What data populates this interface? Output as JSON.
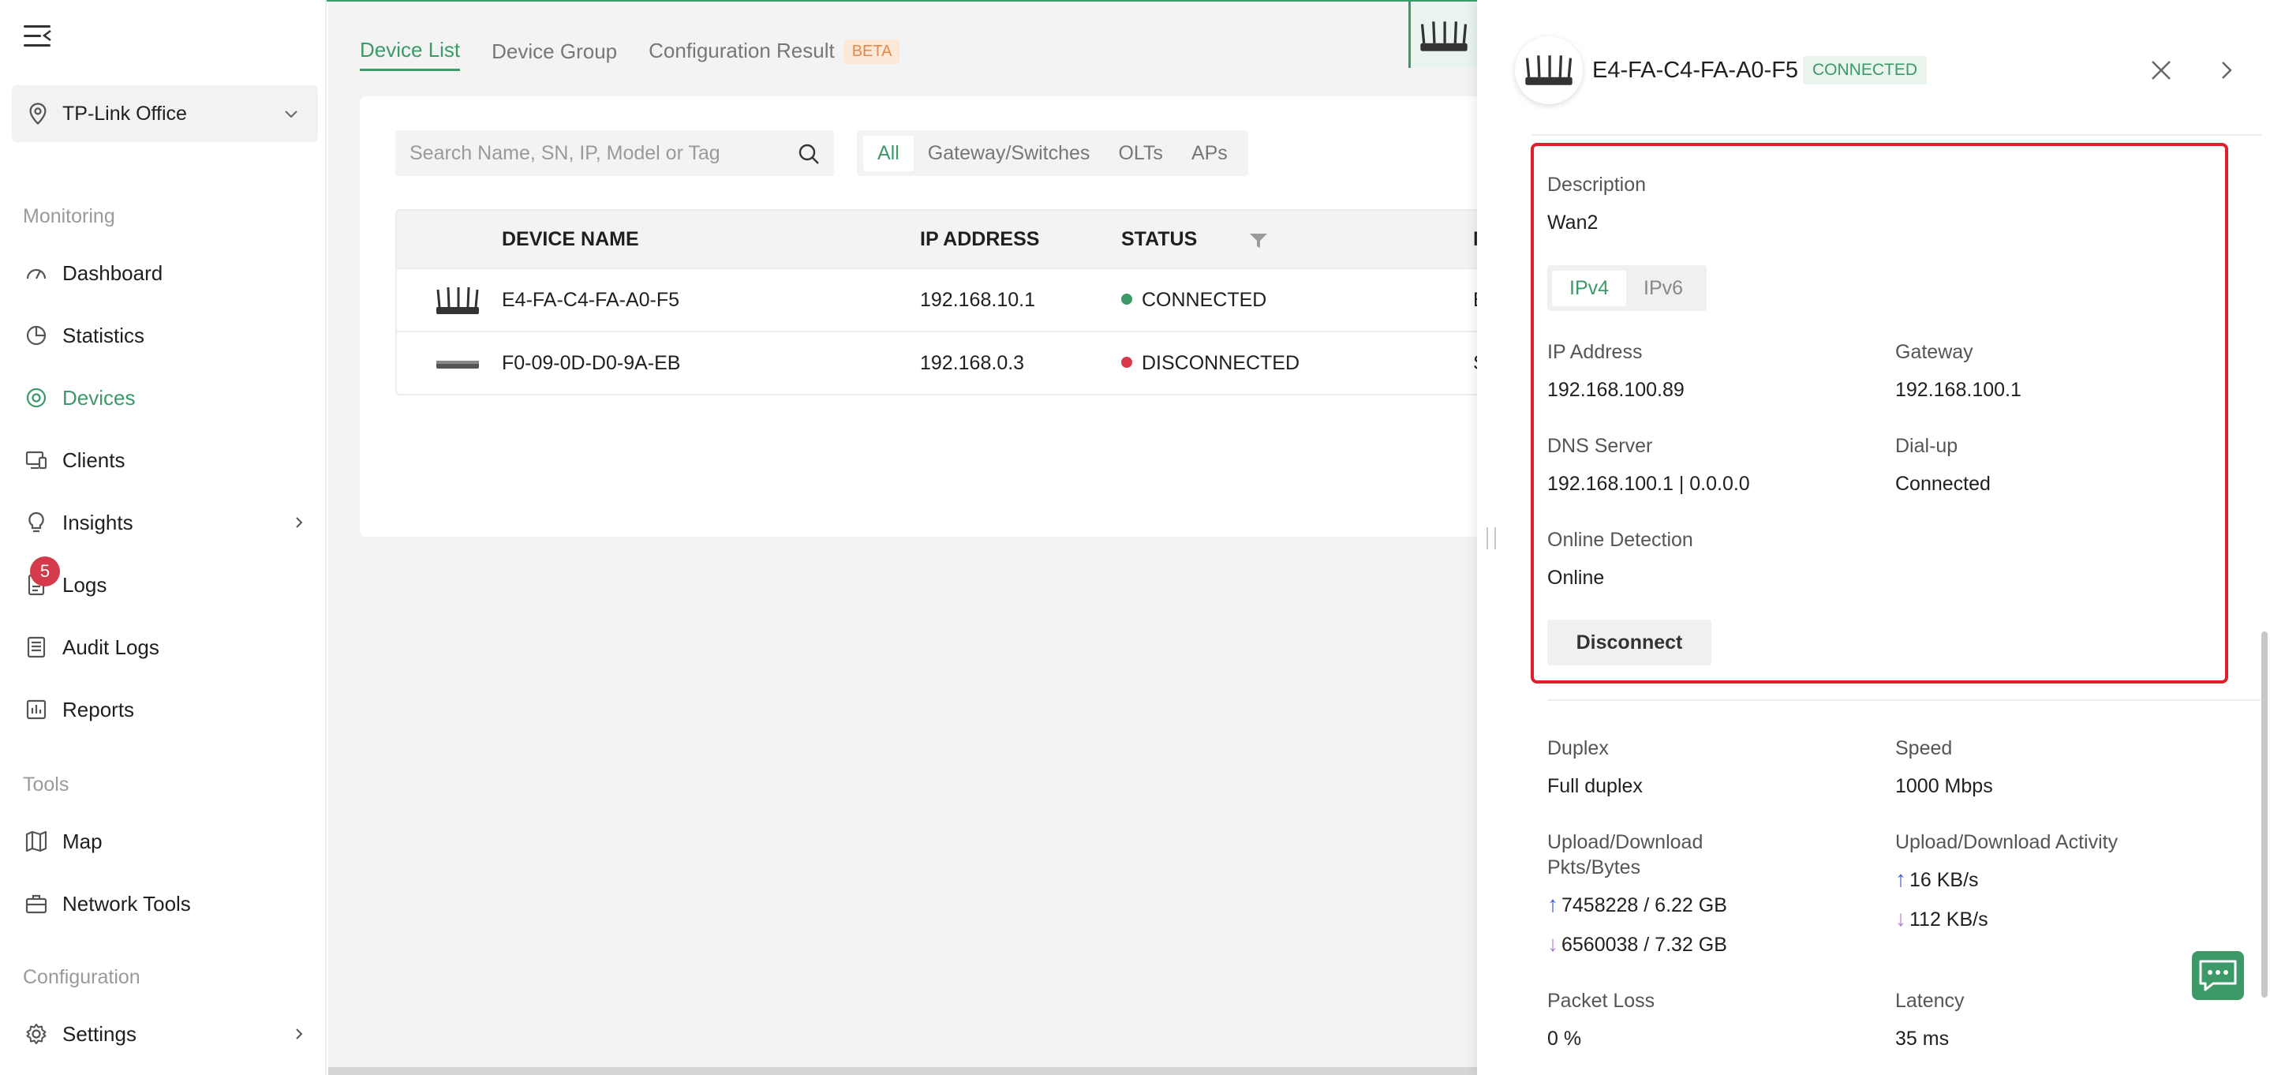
{
  "sidebar": {
    "site": "TP-Link Office",
    "sections": {
      "monitoring": "Monitoring",
      "tools": "Tools",
      "configuration": "Configuration"
    },
    "items": {
      "dashboard": "Dashboard",
      "statistics": "Statistics",
      "devices": "Devices",
      "clients": "Clients",
      "insights": "Insights",
      "logs": "Logs",
      "audit_logs": "Audit Logs",
      "reports": "Reports",
      "map": "Map",
      "network_tools": "Network Tools",
      "settings": "Settings"
    },
    "logs_badge": "5"
  },
  "tabs": {
    "device_list": "Device List",
    "device_group": "Device Group",
    "configuration_result": "Configuration Result",
    "beta": "BETA"
  },
  "search": {
    "placeholder": "Search Name, SN, IP, Model or Tag"
  },
  "filters": {
    "all": "All",
    "gateway_switches": "Gateway/Switches",
    "olts": "OLTs",
    "aps": "APs"
  },
  "table": {
    "headers": {
      "device_name": "DEVICE NAME",
      "ip_address": "IP ADDRESS",
      "status": "STATUS",
      "next": "M"
    },
    "rows": [
      {
        "name": "E4-FA-C4-FA-A0-F5",
        "ip": "192.168.10.1",
        "status": "CONNECTED",
        "next": "E",
        "status_color": "#3d9a68"
      },
      {
        "name": "F0-09-0D-D0-9A-EB",
        "ip": "192.168.0.3",
        "status": "DISCONNECTED",
        "next": "S",
        "status_color": "#d43a4a"
      }
    ]
  },
  "drawer": {
    "device_name": "E4-FA-C4-FA-A0-F5",
    "status": "CONNECTED",
    "description_label": "Description",
    "description_value": "Wan2",
    "ip_tabs": {
      "ipv4": "IPv4",
      "ipv6": "IPv6"
    },
    "ip_address_label": "IP Address",
    "ip_address_value": "192.168.100.89",
    "gateway_label": "Gateway",
    "gateway_value": "192.168.100.1",
    "dns_label": "DNS Server",
    "dns_value": "192.168.100.1 | 0.0.0.0",
    "dialup_label": "Dial-up",
    "dialup_value": "Connected",
    "online_detection_label": "Online Detection",
    "online_detection_value": "Online",
    "disconnect_button": "Disconnect",
    "duplex_label": "Duplex",
    "duplex_value": "Full duplex",
    "speed_label": "Speed",
    "speed_value": "1000 Mbps",
    "pkts_label_line1": "Upload/Download",
    "pkts_label_line2": "Pkts/Bytes",
    "pkts_up": "7458228 / 6.22 GB",
    "pkts_down": "6560038 / 7.32 GB",
    "activity_label": "Upload/Download Activity",
    "activity_up": "16 KB/s",
    "activity_down": "112 KB/s",
    "packet_loss_label": "Packet Loss",
    "packet_loss_value": "0 %",
    "latency_label": "Latency",
    "latency_value": "35 ms"
  },
  "colors": {
    "accent": "#3d9a68",
    "danger": "#d43a4a",
    "highlight": "#e01e2c"
  }
}
